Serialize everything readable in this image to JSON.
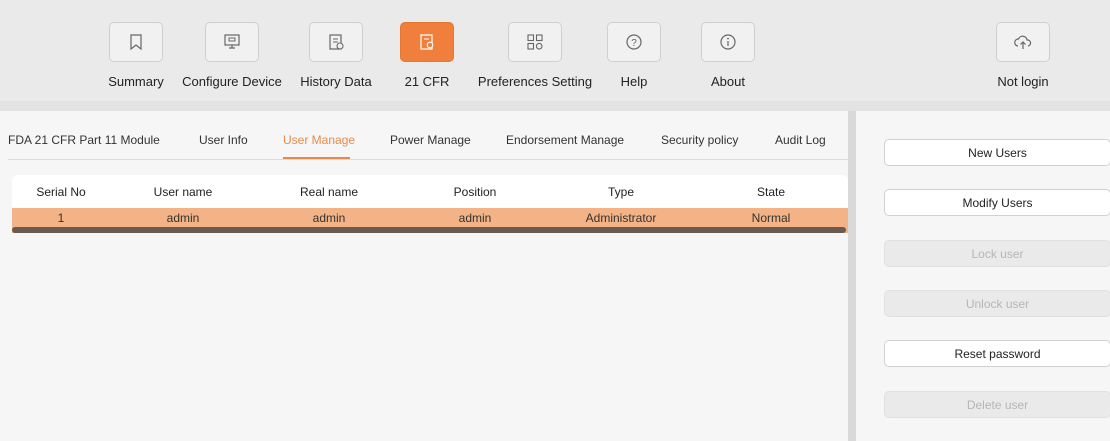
{
  "toolbar": {
    "items": [
      {
        "label": "Summary",
        "icon": "bookmark-icon"
      },
      {
        "label": "Configure Device",
        "icon": "monitor-icon"
      },
      {
        "label": "History Data",
        "icon": "history-document-icon"
      },
      {
        "label": "21 CFR",
        "icon": "compliance-document-icon"
      },
      {
        "label": "Preferences Setting",
        "icon": "grid-settings-icon"
      },
      {
        "label": "Help",
        "icon": "question-circle-icon"
      },
      {
        "label": "About",
        "icon": "info-circle-icon"
      }
    ],
    "login": {
      "label": "Not login",
      "icon": "cloud-upload-icon"
    },
    "accent_color": "#f07f3c"
  },
  "tabs": [
    {
      "label": "FDA 21 CFR Part 11 Module"
    },
    {
      "label": "User Info"
    },
    {
      "label": "User Manage"
    },
    {
      "label": "Power Manage"
    },
    {
      "label": "Endorsement Manage"
    },
    {
      "label": "Security policy"
    },
    {
      "label": "Audit Log"
    }
  ],
  "active_tab": "User Manage",
  "table": {
    "columns": [
      "Serial No",
      "User name",
      "Real name",
      "Position",
      "Type",
      "State"
    ],
    "rows": [
      {
        "serial": "1",
        "user_name": "admin",
        "real_name": "admin",
        "position": "admin",
        "type": "Administrator",
        "state": "Normal"
      }
    ],
    "selected_row_color": "#f3b386"
  },
  "side_buttons": {
    "new_users": "New Users",
    "modify_users": "Modify Users",
    "lock_user": "Lock user",
    "unlock_user": "Unlock user",
    "reset_password": "Reset password",
    "delete_user": "Delete user"
  }
}
